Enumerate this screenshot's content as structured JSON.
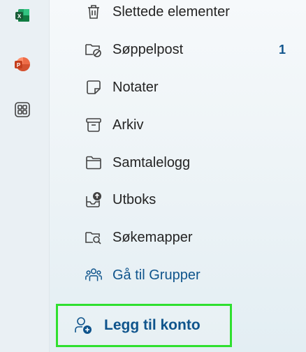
{
  "apps": [
    {
      "name": "excel-icon",
      "label": "X"
    },
    {
      "name": "powerpoint-icon",
      "label": "P"
    },
    {
      "name": "apps-grid-icon",
      "label": ""
    }
  ],
  "folders": [
    {
      "label": "Slettede elementer",
      "count": "",
      "icon": "trash-icon"
    },
    {
      "label": "Søppelpost",
      "count": "1",
      "icon": "junk-folder-icon"
    },
    {
      "label": "Notater",
      "count": "",
      "icon": "note-icon"
    },
    {
      "label": "Arkiv",
      "count": "",
      "icon": "archive-icon"
    },
    {
      "label": "Samtalelogg",
      "count": "",
      "icon": "folder-icon"
    },
    {
      "label": "Utboks",
      "count": "",
      "icon": "outbox-icon"
    },
    {
      "label": "Søkemapper",
      "count": "",
      "icon": "search-folder-icon"
    }
  ],
  "groups_link": {
    "label": "Gå til Grupper",
    "icon": "people-group-icon"
  },
  "add_account": {
    "label": "Legg til konto",
    "icon": "add-person-icon"
  },
  "colors": {
    "accent": "#0f548c",
    "highlight": "#2fe02f",
    "text": "#242424"
  }
}
